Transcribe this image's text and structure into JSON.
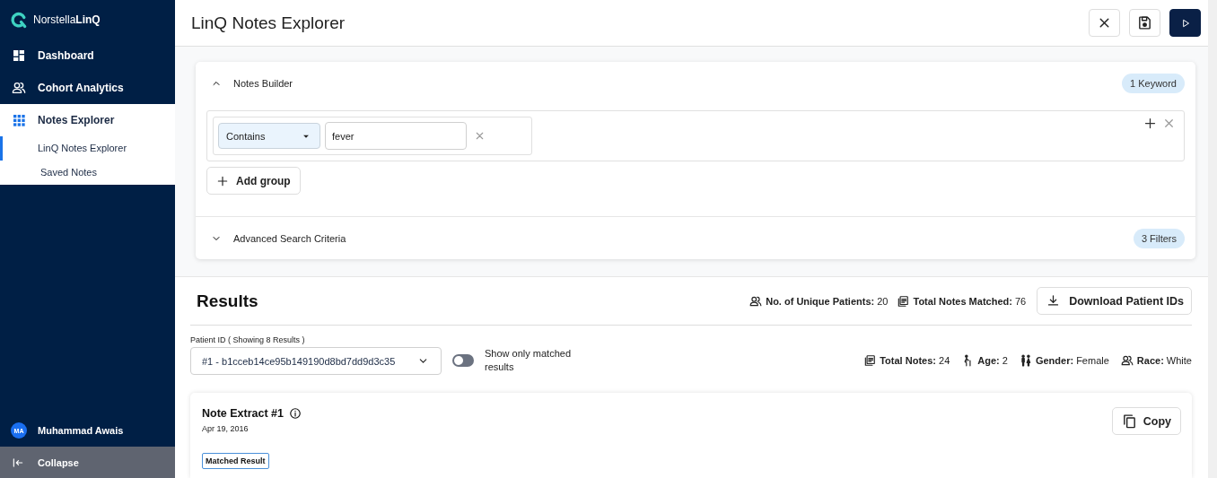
{
  "app": {
    "logo": "Norstella**LinQ**"
  },
  "sidebar": {
    "items": [
      {
        "label": "Dashboard",
        "kind": "dashboard",
        "selected": false
      },
      {
        "label": "Cohort Analytics",
        "kind": "people",
        "selected": false
      },
      {
        "label": "Notes Explorer",
        "kind": "grid",
        "selected": true,
        "expanded": true,
        "children": [
          {
            "label": "LinQ Notes Explorer",
            "selected": true
          },
          {
            "label": "Saved Notes",
            "selected": false
          }
        ]
      }
    ],
    "user": {
      "initials": "MA",
      "name": "Muhammad Awais"
    },
    "collapse": "Collapse"
  },
  "header": {
    "title": "LinQ Notes Explorer",
    "buttons": [
      {
        "kind": "close"
      },
      {
        "kind": "save"
      },
      {
        "kind": "run"
      }
    ]
  },
  "builder": {
    "title": "Notes Builder",
    "expanded": true,
    "badge": "1 Keyword",
    "rows": [
      {
        "operator": "Contains",
        "value": "fever"
      }
    ],
    "add_group": "Add group"
  },
  "advanced": {
    "title": "Advanced Search Criteria",
    "expanded": false,
    "badge": "3 Filters"
  },
  "results": {
    "title": "Results",
    "stats": [
      {
        "kind": "people",
        "text": "**No. of Unique Patients:** 20"
      },
      {
        "kind": "notes",
        "text": "**Total Notes Matched:** 76"
      }
    ],
    "download": "Download Patient IDs",
    "patient_label": "Patient ID ( Showing 8 Results )",
    "patient_value": "#1 - b1cceb14ce95b149190d8bd7dd9d3c35",
    "toggle": {
      "label": "Show only matched results",
      "on": false
    },
    "patient_stats": [
      {
        "kind": "notes",
        "text": "**Total Notes:** 24"
      },
      {
        "kind": "age",
        "text": "**Age:** 2"
      },
      {
        "kind": "gender",
        "text": "**Gender:** Female"
      },
      {
        "kind": "people",
        "text": "**Race:** White"
      }
    ]
  },
  "note": {
    "title": "Note Extract #1",
    "date": "Apr 19, 2016",
    "tag": "Matched Result",
    "copy": "Copy"
  }
}
